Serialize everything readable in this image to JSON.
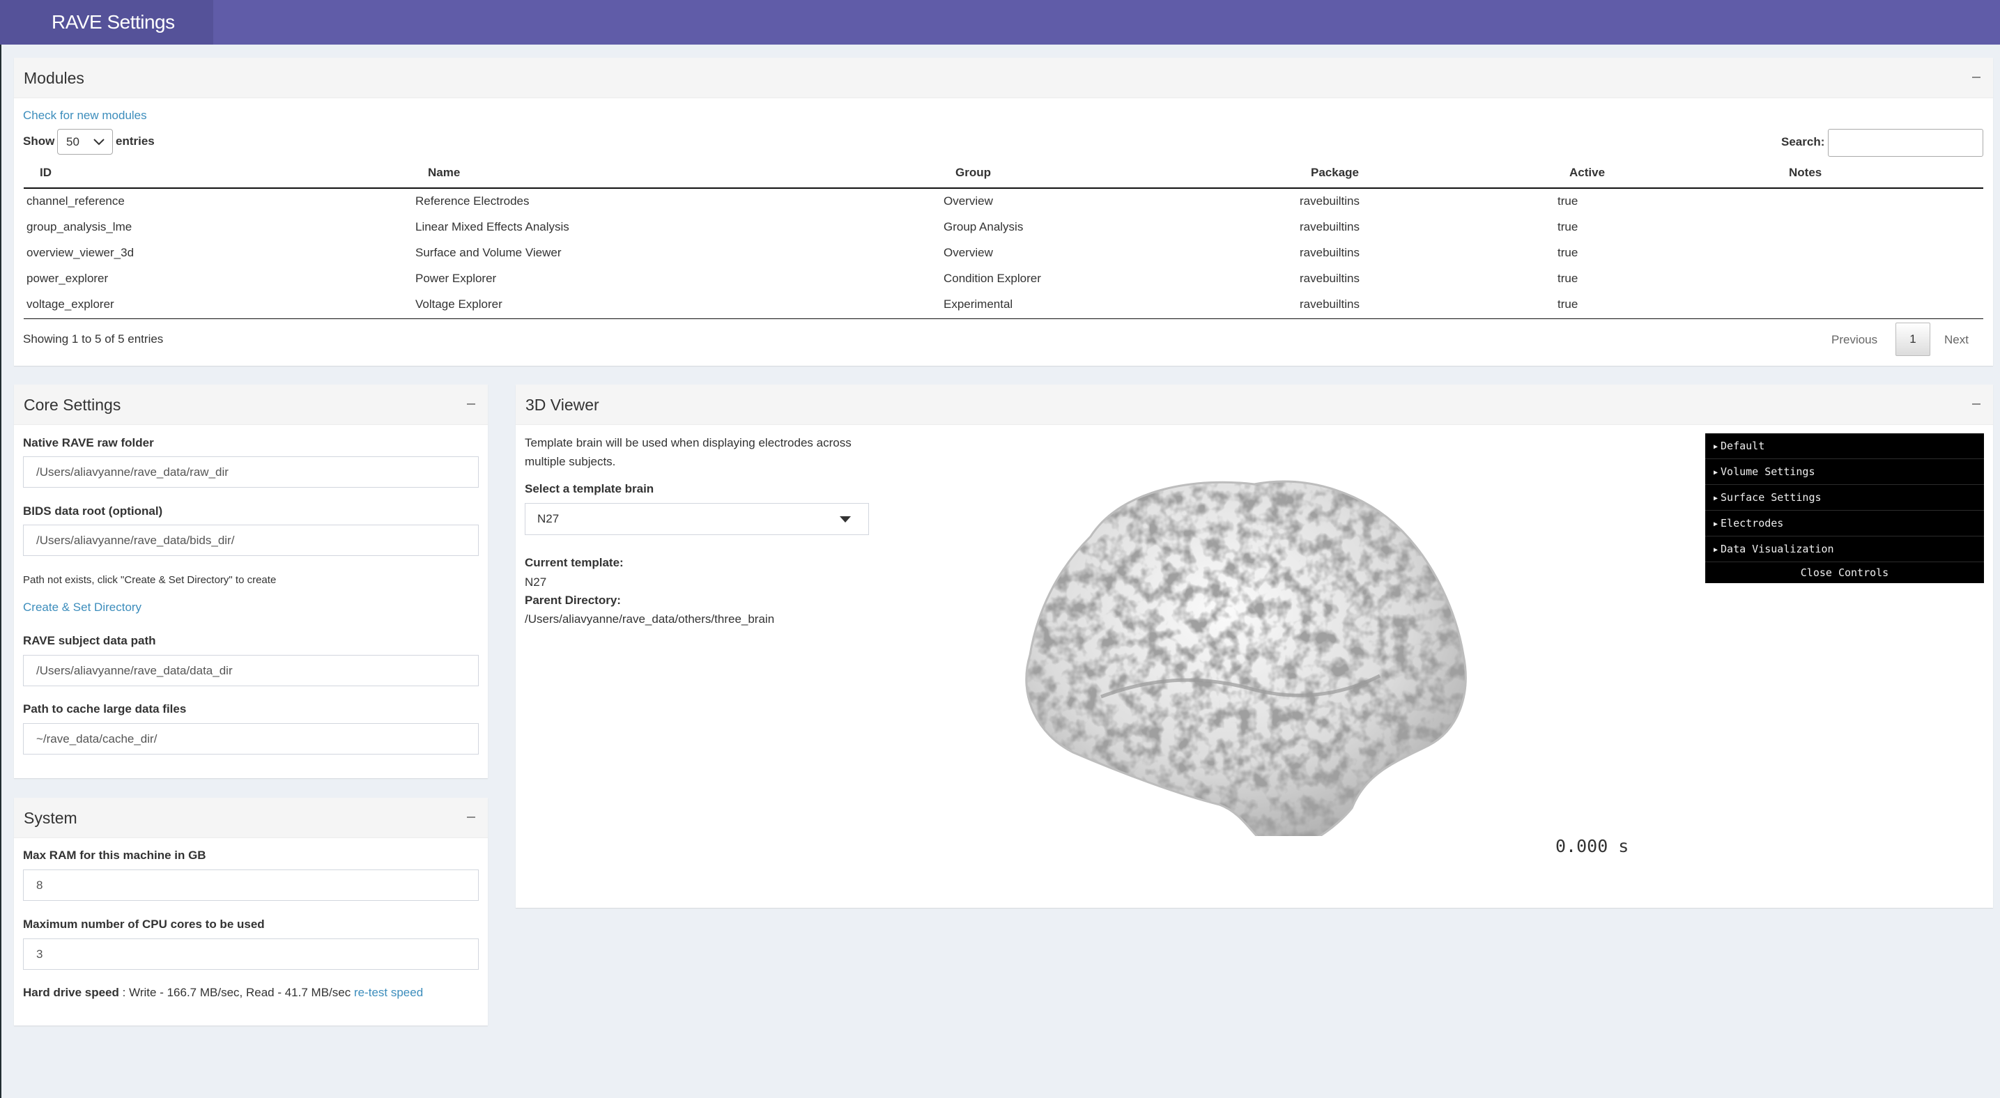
{
  "app": {
    "title": "RAVE Settings"
  },
  "modules": {
    "title": "Modules",
    "check_link": "Check for new modules",
    "show_label": "Show",
    "show_value": "50",
    "entries_label": "entries",
    "search_label": "Search:",
    "search_value": "",
    "columns": [
      "ID",
      "Name",
      "Group",
      "Package",
      "Active",
      "Notes"
    ],
    "rows": [
      [
        "channel_reference",
        "Reference Electrodes",
        "Overview",
        "ravebuiltins",
        "true",
        ""
      ],
      [
        "group_analysis_lme",
        "Linear Mixed Effects Analysis",
        "Group Analysis",
        "ravebuiltins",
        "true",
        ""
      ],
      [
        "overview_viewer_3d",
        "Surface and Volume Viewer",
        "Overview",
        "ravebuiltins",
        "true",
        ""
      ],
      [
        "power_explorer",
        "Power Explorer",
        "Condition Explorer",
        "ravebuiltins",
        "true",
        ""
      ],
      [
        "voltage_explorer",
        "Voltage Explorer",
        "Experimental",
        "ravebuiltins",
        "true",
        ""
      ]
    ],
    "info": "Showing 1 to 5 of 5 entries",
    "pagination": {
      "previous": "Previous",
      "page": "1",
      "next": "Next"
    }
  },
  "core": {
    "title": "Core Settings",
    "raw_label": "Native RAVE raw folder",
    "raw_value": "/Users/aliavyanne/rave_data/raw_dir",
    "bids_label": "BIDS data root (optional)",
    "bids_value": "/Users/aliavyanne/rave_data/bids_dir/",
    "path_note": "Path not exists, click \"Create & Set Directory\" to create",
    "create_link": "Create & Set Directory",
    "subject_label": "RAVE subject data path",
    "subject_value": "/Users/aliavyanne/rave_data/data_dir",
    "cache_label": "Path to cache large data files",
    "cache_value": "~/rave_data/cache_dir/"
  },
  "system": {
    "title": "System",
    "ram_label": "Max RAM for this machine in GB",
    "ram_value": "8",
    "cpu_label": "Maximum number of CPU cores to be used",
    "cpu_value": "3",
    "drive_label": "Hard drive speed",
    "drive_text": " : Write - 166.7 MB/sec, Read - 41.7 MB/sec ",
    "retest_link": "re-test speed"
  },
  "viewer": {
    "title": "3D Viewer",
    "desc_line1": "Template brain will be used when displaying electrodes across",
    "desc_line2": "multiple subjects.",
    "select_label": "Select a template brain",
    "select_value": "N27",
    "current_label": "Current template:",
    "current_value": "N27",
    "parent_label": "Parent Directory:",
    "parent_value": "/Users/aliavyanne/rave_data/others/three_brain",
    "time_display": "0.000 s",
    "controls": [
      "Default",
      "Volume Settings",
      "Surface Settings",
      "Electrodes",
      "Data Visualization"
    ],
    "close_controls": "Close Controls"
  }
}
